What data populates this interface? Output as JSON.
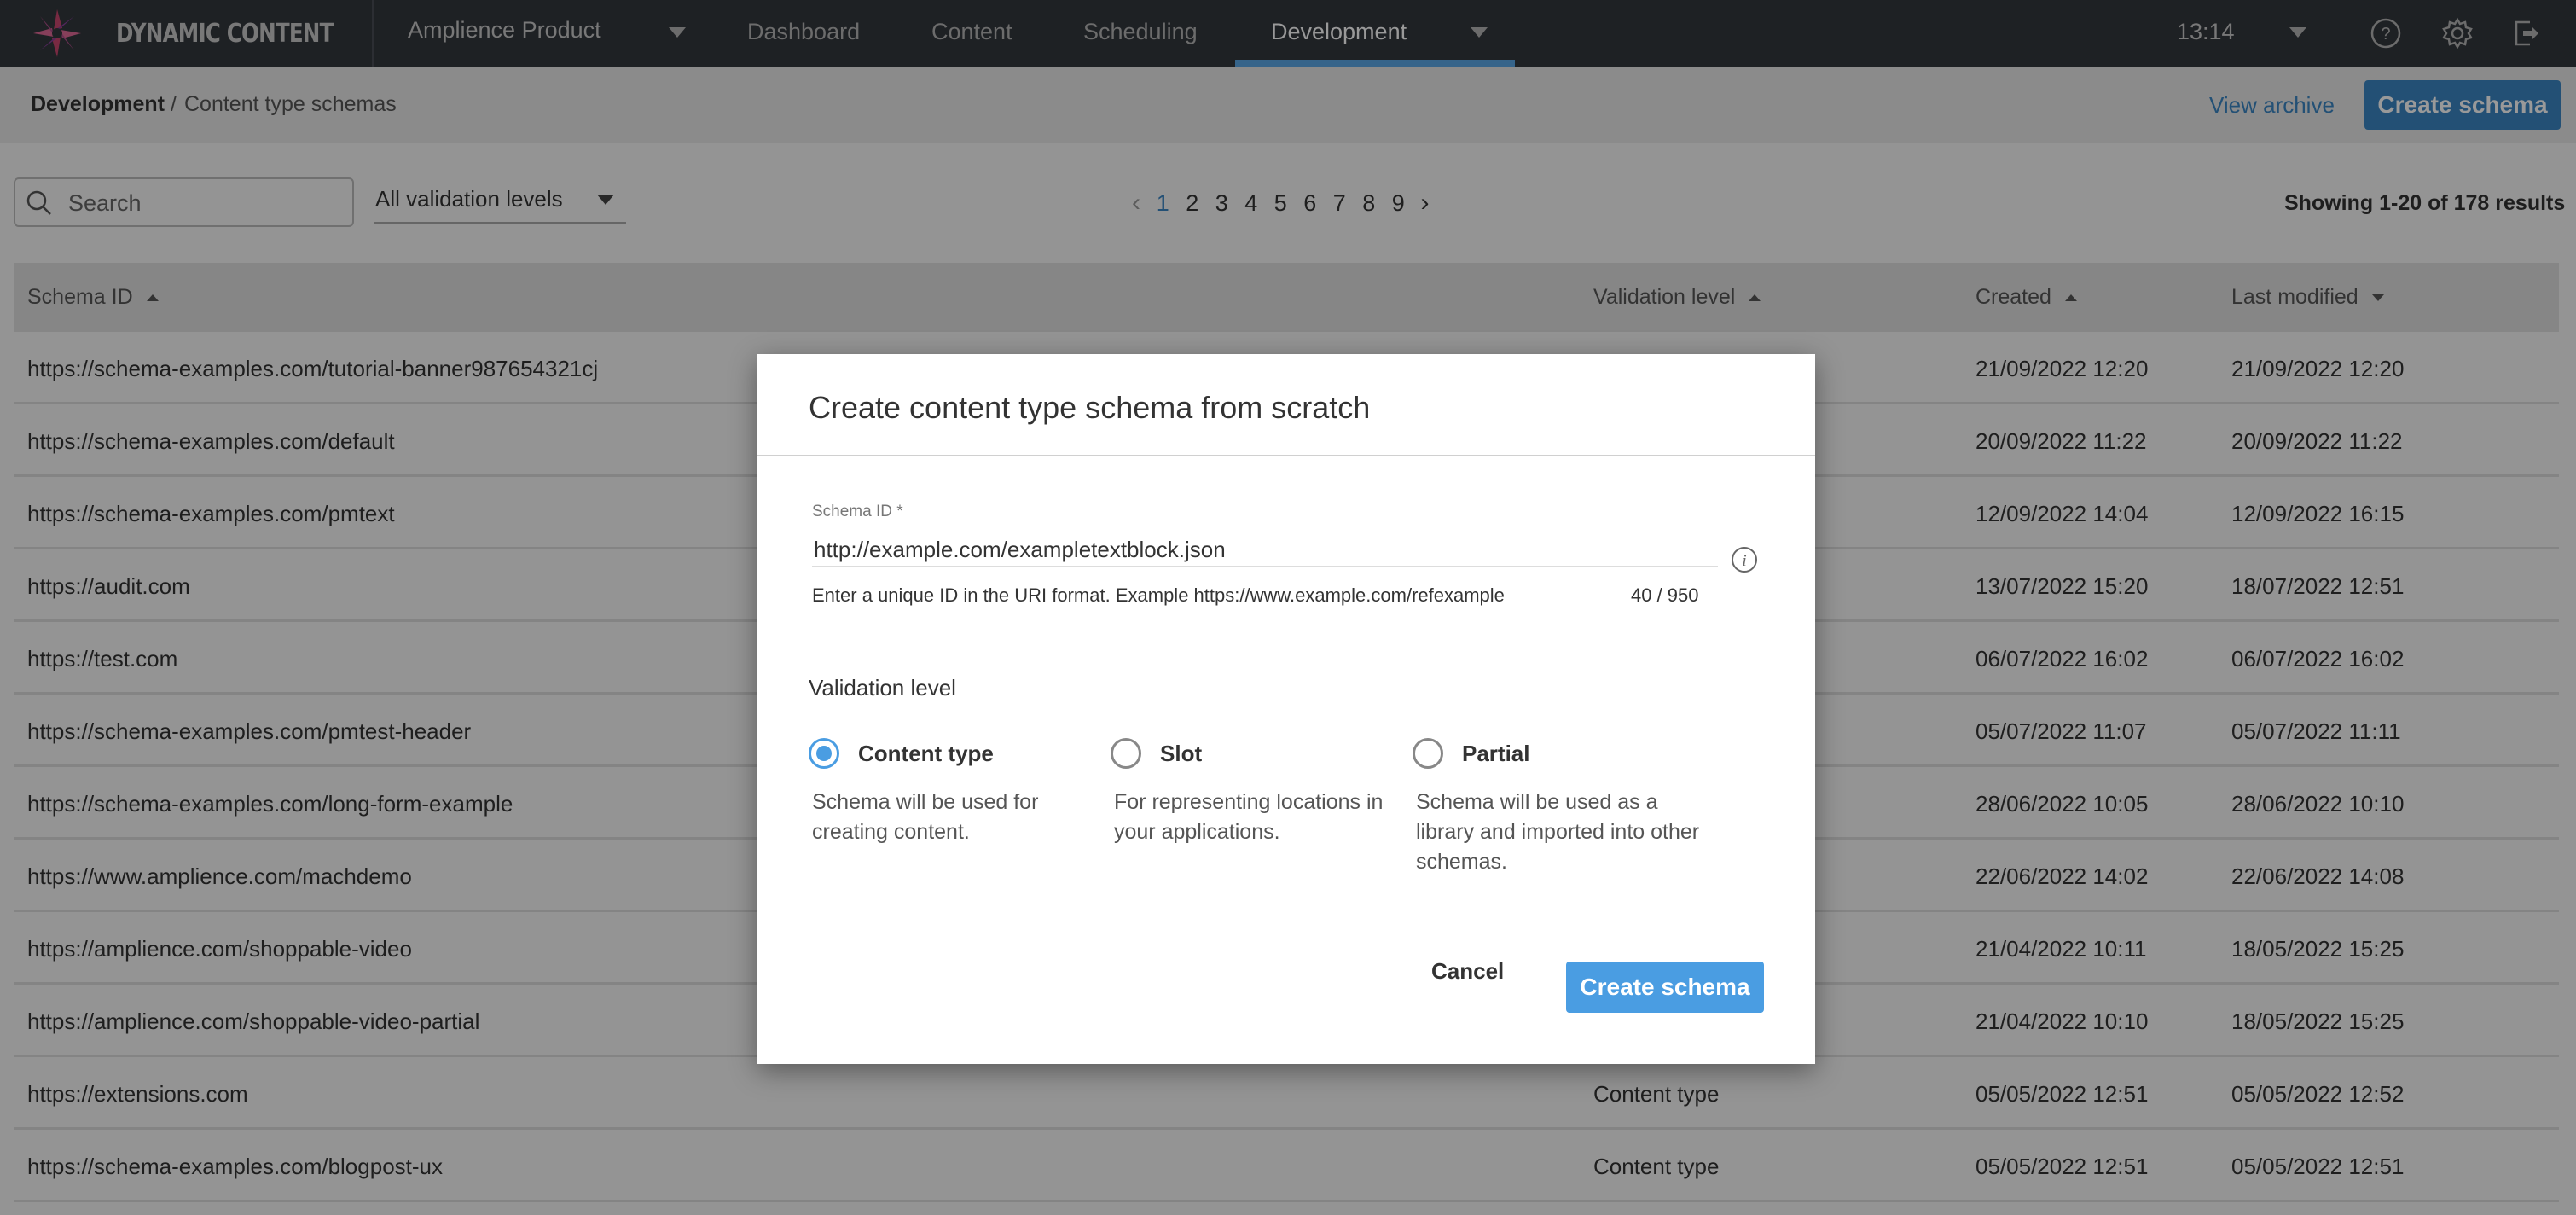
{
  "topbar": {
    "brand": "DYNAMIC CONTENT",
    "hub": "Amplience Product",
    "tabs": [
      {
        "label": "Dashboard",
        "active": false
      },
      {
        "label": "Content",
        "active": false
      },
      {
        "label": "Scheduling",
        "active": false
      },
      {
        "label": "Development",
        "active": true
      }
    ],
    "clock": "13:14",
    "icons": [
      "help-icon",
      "settings-icon",
      "logout-icon"
    ]
  },
  "breadcrumb": {
    "root": "Development",
    "separator": "/",
    "current": "Content type schemas"
  },
  "actions": {
    "view_archive": "View archive",
    "create_schema": "Create schema"
  },
  "toolbar": {
    "search_placeholder": "Search",
    "validation_filter": "All validation levels",
    "pagination": {
      "pages": [
        "1",
        "2",
        "3",
        "4",
        "5",
        "6",
        "7",
        "8",
        "9"
      ],
      "current": "1"
    },
    "results": "Showing 1-20 of 178 results"
  },
  "table": {
    "columns": [
      "Schema ID",
      "Validation level",
      "Created",
      "Last modified"
    ],
    "rows": [
      {
        "id": "https://schema-examples.com/tutorial-banner987654321cj",
        "level": "",
        "created": "21/09/2022 12:20",
        "modified": "21/09/2022 12:20"
      },
      {
        "id": "https://schema-examples.com/default",
        "level": "",
        "created": "20/09/2022 11:22",
        "modified": "20/09/2022 11:22"
      },
      {
        "id": "https://schema-examples.com/pmtext",
        "level": "",
        "created": "12/09/2022 14:04",
        "modified": "12/09/2022 16:15"
      },
      {
        "id": "https://audit.com",
        "level": "",
        "created": "13/07/2022 15:20",
        "modified": "18/07/2022 12:51"
      },
      {
        "id": "https://test.com",
        "level": "",
        "created": "06/07/2022 16:02",
        "modified": "06/07/2022 16:02"
      },
      {
        "id": "https://schema-examples.com/pmtest-header",
        "level": "",
        "created": "05/07/2022 11:07",
        "modified": "05/07/2022 11:11"
      },
      {
        "id": "https://schema-examples.com/long-form-example",
        "level": "",
        "created": "28/06/2022 10:05",
        "modified": "28/06/2022 10:10"
      },
      {
        "id": "https://www.amplience.com/machdemo",
        "level": "",
        "created": "22/06/2022 14:02",
        "modified": "22/06/2022 14:08"
      },
      {
        "id": "https://amplience.com/shoppable-video",
        "level": "",
        "created": "21/04/2022 10:11",
        "modified": "18/05/2022 15:25"
      },
      {
        "id": "https://amplience.com/shoppable-video-partial",
        "level": "",
        "created": "21/04/2022 10:10",
        "modified": "18/05/2022 15:25"
      },
      {
        "id": "https://extensions.com",
        "level": "Content type",
        "created": "05/05/2022 12:51",
        "modified": "05/05/2022 12:52"
      },
      {
        "id": "https://schema-examples.com/blogpost-ux",
        "level": "Content type",
        "created": "05/05/2022 12:51",
        "modified": "05/05/2022 12:51"
      }
    ]
  },
  "dialog": {
    "title": "Create content type schema from scratch",
    "schema_id_label": "Schema ID *",
    "schema_id_value": "http://example.com/exampletextblock.json",
    "schema_id_help": "Enter a unique ID in the URI format. Example https://www.example.com/refexample",
    "schema_id_count": "40 / 950",
    "validation_label": "Validation level",
    "options": [
      {
        "label": "Content type",
        "description": "Schema will be used for creating content.",
        "checked": true
      },
      {
        "label": "Slot",
        "description": "For representing locations in your applications.",
        "checked": false
      },
      {
        "label": "Partial",
        "description": "Schema will be used as a library and imported into other schemas.",
        "checked": false
      }
    ],
    "cancel": "Cancel",
    "create": "Create schema"
  },
  "colors": {
    "accent": "#4a9de2",
    "topbar": "#33373d"
  }
}
